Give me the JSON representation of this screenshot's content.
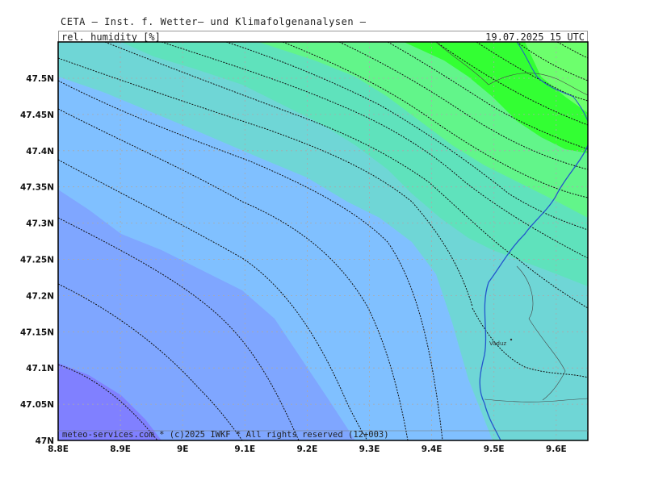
{
  "header": {
    "title": "CETA — Inst. f. Wetter— und Klimafolgenanalysen —",
    "variable": "rel. humidity [%]",
    "valid_time": "19.07.2025  15 UTC"
  },
  "footer": {
    "credit": "meteo-services.com * (c)2025 IWKF * All rights reserved (12+003)"
  },
  "map": {
    "lon_ticks": [
      "8.8E",
      "8.9E",
      "9E",
      "9.1E",
      "9.2E",
      "9.3E",
      "9.4E",
      "9.5E",
      "9.6E"
    ],
    "lat_ticks": [
      "47N",
      "47.05N",
      "47.1N",
      "47.15N",
      "47.2N",
      "47.25N",
      "47.3N",
      "47.35N",
      "47.4N",
      "47.45N",
      "47.5N"
    ],
    "cities": [
      {
        "name": "Vaduz"
      }
    ],
    "colors": {
      "violet": "#8080ff",
      "blue": "#7fa6ff",
      "lightblue": "#80c0ff",
      "teal": "#6fd6d6",
      "turquoise": "#5fe2bc",
      "lightgreen": "#62f58a",
      "green": "#33ff33",
      "border_blue": "#2255cc",
      "contour": "#111111",
      "grid": "#aaaaaa"
    }
  }
}
